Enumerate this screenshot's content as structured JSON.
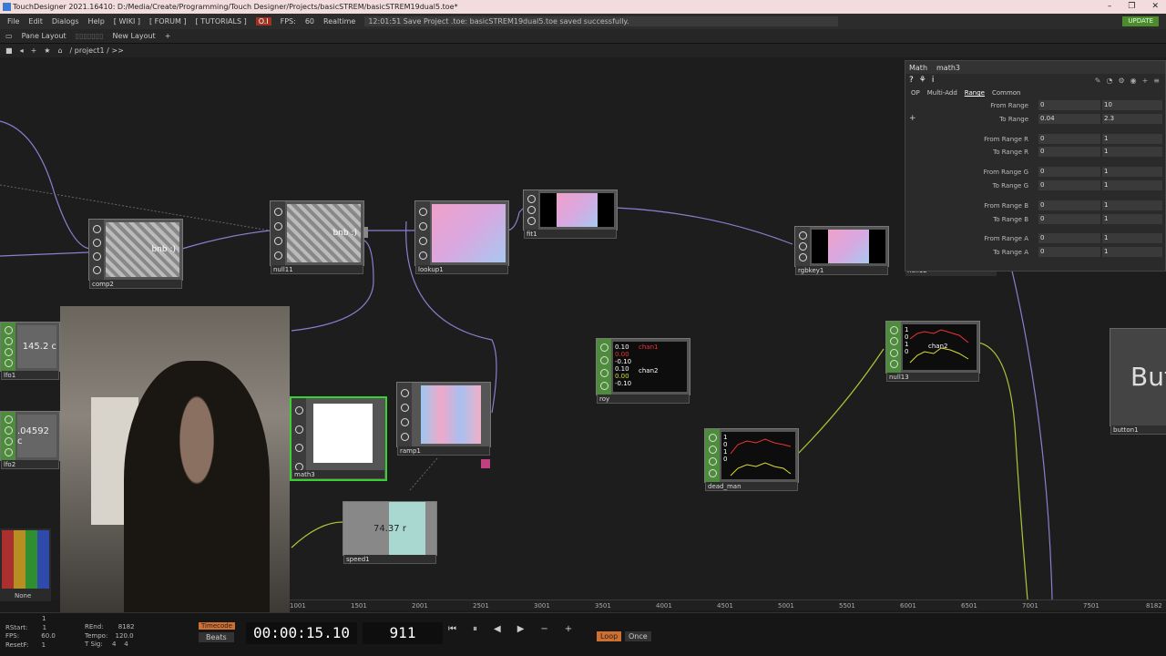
{
  "window": {
    "title": "TouchDesigner 2021.16410: D:/Media/Create/Programming/Touch Designer/Projects/basicSTREM/basicSTREM19dual5.toe*",
    "controls": [
      "–",
      "❐",
      "✕"
    ]
  },
  "menubar": {
    "items": [
      "File",
      "Edit",
      "Dialogs",
      "Help"
    ],
    "links": [
      "[ WIKI ]",
      "[ FORUM ]",
      "[ TUTORIALS ]"
    ],
    "oi": "O.I",
    "fps_label": "FPS:",
    "fps_value": "60",
    "realtime": "Realtime",
    "status": "12:01:51 Save Project .toe: basicSTREM19dual5.toe saved successfully.",
    "update": "UPDATE"
  },
  "panebar": {
    "pane_layout": "Pane Layout",
    "new_layout": "New Layout",
    "plus": "+"
  },
  "pathbar": {
    "path": "/ project1 / >>"
  },
  "nodes": {
    "comp2": {
      "label": "comp2",
      "text": "bnb :)"
    },
    "null11": {
      "label": "null11",
      "text": "bnb :)"
    },
    "lookup1": {
      "label": "lookup1"
    },
    "fit1": {
      "label": "fit1"
    },
    "rgbkey1": {
      "label": "rgbkey1"
    },
    "null12": {
      "label": "null12"
    },
    "lfo1": {
      "label": "lfo1",
      "value": "145.2 c"
    },
    "lfo2": {
      "label": "lfo2",
      "value": ".04592 c"
    },
    "math3": {
      "label": "math3"
    },
    "ramp1": {
      "label": "ramp1"
    },
    "speed1": {
      "label": "speed1",
      "value": "74.37 r"
    },
    "roy": {
      "label": "roy",
      "line1": "0.10",
      "line2": "0.00",
      "line3": "-0.10",
      "line4": "0.10",
      "line5": "0.00",
      "line6": "-0.10",
      "chan1": "chan1",
      "chan2": "chan2"
    },
    "null13": {
      "label": "null13",
      "line1": "1",
      "line2": "0",
      "line3": "1",
      "line4": "0",
      "chan2": "chan2"
    },
    "dead_man": {
      "label": "dead_man",
      "line1": "1",
      "line2": "0",
      "line3": "1",
      "line4": "0"
    },
    "button1": {
      "label": "button1",
      "text": "Butt"
    }
  },
  "params": {
    "type": "Math",
    "name": "math3",
    "tabs": [
      "OP",
      "Multi-Add",
      "Range",
      "Common"
    ],
    "active_tab": "Range",
    "rows": [
      {
        "name": "From Range",
        "v1": "0",
        "v2": "10"
      },
      {
        "name": "To Range",
        "v1": "0.04",
        "v2": "2.3"
      },
      {
        "name": "From Range R",
        "v1": "0",
        "v2": "1"
      },
      {
        "name": "To Range R",
        "v1": "0",
        "v2": "1"
      },
      {
        "name": "From Range G",
        "v1": "0",
        "v2": "1"
      },
      {
        "name": "To Range G",
        "v1": "0",
        "v2": "1"
      },
      {
        "name": "From Range B",
        "v1": "0",
        "v2": "1"
      },
      {
        "name": "To Range B",
        "v1": "0",
        "v2": "1"
      },
      {
        "name": "From Range A",
        "v1": "0",
        "v2": "1"
      },
      {
        "name": "To Range A",
        "v1": "0",
        "v2": "1"
      }
    ]
  },
  "swatches": {
    "label": "None"
  },
  "timeline": {
    "ticks": [
      "1001",
      "1501",
      "2001",
      "2501",
      "3001",
      "3501",
      "4001",
      "4501",
      "5001",
      "5501",
      "6001",
      "6501",
      "7001",
      "7501",
      "8182"
    ]
  },
  "transport": {
    "rstart_label": "RStart:",
    "rstart": "1",
    "fps_label": "FPS:",
    "fps": "60.0",
    "resetf_label": "ResetF:",
    "resetf": "1",
    "top_value": "1",
    "rend_label": "REnd:",
    "rend": "8182",
    "tempo_label": "Tempo:",
    "tempo": "120.0",
    "tsig_label": "T Sig:",
    "tsig": "4    4",
    "timecode_btn": "Timecode",
    "beats_btn": "Beats",
    "timecode": "00:00:15.10",
    "frame": "911",
    "buttons": [
      "⏮",
      "⏸",
      "◀",
      "▶",
      "−",
      "+"
    ],
    "loop": "Loop",
    "once": "Once"
  },
  "colors": {
    "accent": "#d07030",
    "node_green": "#4c8c3a",
    "selected": "#3ad030",
    "wire": "#8a7fd0",
    "wire_chop": "#a8c838"
  }
}
